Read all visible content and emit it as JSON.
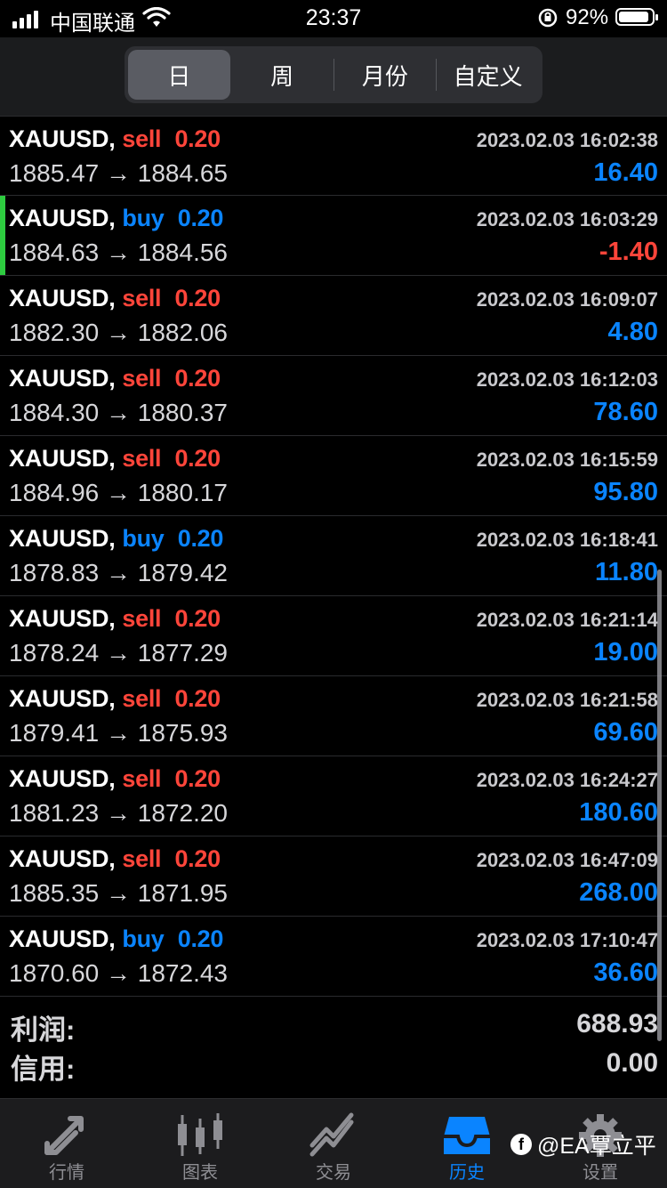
{
  "status_bar": {
    "carrier": "中国联通",
    "time": "23:37",
    "battery_percent": "92%",
    "battery_level": 0.92
  },
  "period_tabs": [
    {
      "label": "日",
      "active": true
    },
    {
      "label": "周",
      "active": false
    },
    {
      "label": "月份",
      "active": false
    },
    {
      "label": "自定义",
      "active": false
    }
  ],
  "deals": [
    {
      "symbol": "XAUUSD,",
      "side": "sell",
      "volume": "0.20",
      "time": "2023.02.03 16:02:38",
      "open": "1885.47",
      "close": "1884.65",
      "profit": "16.40"
    },
    {
      "symbol": "XAUUSD,",
      "side": "buy",
      "volume": "0.20",
      "time": "2023.02.03 16:03:29",
      "open": "1884.63",
      "close": "1884.56",
      "profit": "-1.40"
    },
    {
      "symbol": "XAUUSD,",
      "side": "sell",
      "volume": "0.20",
      "time": "2023.02.03 16:09:07",
      "open": "1882.30",
      "close": "1882.06",
      "profit": "4.80"
    },
    {
      "symbol": "XAUUSD,",
      "side": "sell",
      "volume": "0.20",
      "time": "2023.02.03 16:12:03",
      "open": "1884.30",
      "close": "1880.37",
      "profit": "78.60"
    },
    {
      "symbol": "XAUUSD,",
      "side": "sell",
      "volume": "0.20",
      "time": "2023.02.03 16:15:59",
      "open": "1884.96",
      "close": "1880.17",
      "profit": "95.80"
    },
    {
      "symbol": "XAUUSD,",
      "side": "buy",
      "volume": "0.20",
      "time": "2023.02.03 16:18:41",
      "open": "1878.83",
      "close": "1879.42",
      "profit": "11.80"
    },
    {
      "symbol": "XAUUSD,",
      "side": "sell",
      "volume": "0.20",
      "time": "2023.02.03 16:21:14",
      "open": "1878.24",
      "close": "1877.29",
      "profit": "19.00"
    },
    {
      "symbol": "XAUUSD,",
      "side": "sell",
      "volume": "0.20",
      "time": "2023.02.03 16:21:58",
      "open": "1879.41",
      "close": "1875.93",
      "profit": "69.60"
    },
    {
      "symbol": "XAUUSD,",
      "side": "sell",
      "volume": "0.20",
      "time": "2023.02.03 16:24:27",
      "open": "1881.23",
      "close": "1872.20",
      "profit": "180.60"
    },
    {
      "symbol": "XAUUSD,",
      "side": "sell",
      "volume": "0.20",
      "time": "2023.02.03 16:47:09",
      "open": "1885.35",
      "close": "1871.95",
      "profit": "268.00"
    },
    {
      "symbol": "XAUUSD,",
      "side": "buy",
      "volume": "0.20",
      "time": "2023.02.03 17:10:47",
      "open": "1870.60",
      "close": "1872.43",
      "profit": "36.60"
    }
  ],
  "summary": {
    "profit_label": "利润:",
    "profit_value": "688.93",
    "credit_label": "信用:",
    "credit_value": "0.00"
  },
  "tabbar": [
    {
      "label": "行情",
      "icon": "quotes-arrows-icon",
      "active": false
    },
    {
      "label": "图表",
      "icon": "candlestick-chart-icon",
      "active": false
    },
    {
      "label": "交易",
      "icon": "trade-line-icon",
      "active": false
    },
    {
      "label": "历史",
      "icon": "history-inbox-icon",
      "active": true
    },
    {
      "label": "设置",
      "icon": "gear-icon",
      "active": false
    }
  ],
  "watermark": "@EA覃立平",
  "colors": {
    "sell": "#ff453a",
    "buy": "#0a84ff",
    "profit_positive": "#0a84ff",
    "profit_negative": "#ff453a",
    "active_tab": "#0a84ff",
    "row_accent": "#2ecc40"
  }
}
